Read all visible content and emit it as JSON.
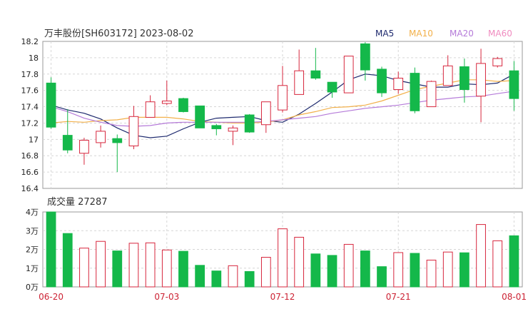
{
  "chart_data": {
    "type": "candlestick",
    "title": "万丰股份[SH603172] 2023-08-02",
    "legend": [
      {
        "label": "MA5",
        "color": "#1e2a6e"
      },
      {
        "label": "MA10",
        "color": "#f2b04a"
      },
      {
        "label": "MA20",
        "color": "#b57bd9"
      },
      {
        "label": "MA60",
        "color": "#f08cc0"
      }
    ],
    "colors": {
      "up": "#d7263d",
      "down": "#14b84a"
    },
    "price_axis": {
      "ylim": [
        16.4,
        18.2
      ],
      "ticks": [
        "18.2",
        "18",
        "17.8",
        "17.6",
        "17.4",
        "17.2",
        "17",
        "16.8",
        "16.6",
        "16.4"
      ],
      "tick_values": [
        18.2,
        18.0,
        17.8,
        17.6,
        17.4,
        17.2,
        17.0,
        16.8,
        16.6,
        16.4
      ]
    },
    "volume_title": "成交量 27287",
    "volume_axis": {
      "ylim": [
        0,
        40000
      ],
      "ticks": [
        "4万",
        "3万",
        "2万",
        "1万",
        "0万"
      ],
      "tick_values": [
        40000,
        30000,
        20000,
        10000,
        0
      ]
    },
    "x_ticks": [
      {
        "index": 0,
        "label": "06-20"
      },
      {
        "index": 7,
        "label": "07-03"
      },
      {
        "index": 14,
        "label": "07-12"
      },
      {
        "index": 21,
        "label": "07-21"
      },
      {
        "index": 28,
        "label": "08-01"
      }
    ],
    "candles": [
      {
        "o": 17.69,
        "h": 17.76,
        "l": 17.13,
        "c": 17.15,
        "v": 40000
      },
      {
        "o": 17.05,
        "h": 17.37,
        "l": 16.83,
        "c": 16.87,
        "v": 28500
      },
      {
        "o": 16.83,
        "h": 17.02,
        "l": 16.69,
        "c": 16.99,
        "v": 20700
      },
      {
        "o": 16.96,
        "h": 17.17,
        "l": 16.9,
        "c": 17.1,
        "v": 24300
      },
      {
        "o": 17.01,
        "h": 17.06,
        "l": 16.6,
        "c": 16.96,
        "v": 19200
      },
      {
        "o": 16.92,
        "h": 17.41,
        "l": 16.88,
        "c": 17.28,
        "v": 23300
      },
      {
        "o": 17.27,
        "h": 17.54,
        "l": 17.27,
        "c": 17.46,
        "v": 23500
      },
      {
        "o": 17.44,
        "h": 17.72,
        "l": 17.42,
        "c": 17.47,
        "v": 19700
      },
      {
        "o": 17.5,
        "h": 17.51,
        "l": 17.33,
        "c": 17.34,
        "v": 19000
      },
      {
        "o": 17.41,
        "h": 17.41,
        "l": 17.14,
        "c": 17.14,
        "v": 11500
      },
      {
        "o": 17.17,
        "h": 17.19,
        "l": 17.05,
        "c": 17.13,
        "v": 8500
      },
      {
        "o": 17.1,
        "h": 17.17,
        "l": 16.93,
        "c": 17.14,
        "v": 11300
      },
      {
        "o": 17.3,
        "h": 17.31,
        "l": 17.08,
        "c": 17.09,
        "v": 8200
      },
      {
        "o": 17.18,
        "h": 17.46,
        "l": 17.08,
        "c": 17.46,
        "v": 15800
      },
      {
        "o": 17.36,
        "h": 17.9,
        "l": 17.33,
        "c": 17.66,
        "v": 31000
      },
      {
        "o": 17.55,
        "h": 18.1,
        "l": 17.55,
        "c": 17.84,
        "v": 26500
      },
      {
        "o": 17.84,
        "h": 18.12,
        "l": 17.73,
        "c": 17.75,
        "v": 17600
      },
      {
        "o": 17.7,
        "h": 17.7,
        "l": 17.51,
        "c": 17.58,
        "v": 16800
      },
      {
        "o": 17.57,
        "h": 18.01,
        "l": 17.57,
        "c": 18.02,
        "v": 22700
      },
      {
        "o": 18.17,
        "h": 18.19,
        "l": 17.72,
        "c": 17.85,
        "v": 19200
      },
      {
        "o": 17.86,
        "h": 17.89,
        "l": 17.52,
        "c": 17.57,
        "v": 10800
      },
      {
        "o": 17.61,
        "h": 17.83,
        "l": 17.56,
        "c": 17.75,
        "v": 18300
      },
      {
        "o": 17.81,
        "h": 17.88,
        "l": 17.32,
        "c": 17.35,
        "v": 17900
      },
      {
        "o": 17.4,
        "h": 17.72,
        "l": 17.4,
        "c": 17.71,
        "v": 14300
      },
      {
        "o": 17.66,
        "h": 18.03,
        "l": 17.66,
        "c": 17.9,
        "v": 18600
      },
      {
        "o": 17.89,
        "h": 17.99,
        "l": 17.45,
        "c": 17.61,
        "v": 18200
      },
      {
        "o": 17.53,
        "h": 18.11,
        "l": 17.21,
        "c": 17.93,
        "v": 33300
      },
      {
        "o": 17.9,
        "h": 18.01,
        "l": 17.88,
        "c": 17.99,
        "v": 24600
      },
      {
        "o": 17.84,
        "h": 17.96,
        "l": 17.35,
        "c": 17.5,
        "v": 27287
      }
    ],
    "ma": [
      {
        "name": "MA5",
        "color": "#1e2a6e",
        "values": [
          17.42,
          17.36,
          17.32,
          17.25,
          17.14,
          17.05,
          17.02,
          17.04,
          17.13,
          17.21,
          17.26,
          17.27,
          17.28,
          17.23,
          17.21,
          17.31,
          17.44,
          17.58,
          17.73,
          17.8,
          17.78,
          17.72,
          17.68,
          17.64,
          17.64,
          17.68,
          17.67,
          17.69,
          17.8
        ]
      },
      {
        "name": "MA10",
        "color": "#f2b04a",
        "values": [
          17.2,
          17.22,
          17.21,
          17.23,
          17.24,
          17.27,
          17.27,
          17.27,
          17.25,
          17.22,
          17.21,
          17.2,
          17.2,
          17.21,
          17.24,
          17.3,
          17.34,
          17.39,
          17.4,
          17.42,
          17.47,
          17.54,
          17.61,
          17.65,
          17.69,
          17.73,
          17.73,
          17.71,
          17.72
        ]
      },
      {
        "name": "MA20",
        "color": "#b57bd9",
        "values": [
          17.4,
          17.34,
          17.26,
          17.21,
          17.17,
          17.16,
          17.17,
          17.2,
          17.21,
          17.21,
          17.21,
          17.21,
          17.21,
          17.22,
          17.24,
          17.26,
          17.28,
          17.32,
          17.35,
          17.38,
          17.4,
          17.42,
          17.45,
          17.48,
          17.5,
          17.52,
          17.53,
          17.56,
          17.59
        ]
      },
      {
        "name": "MA60",
        "color": "#f08cc0",
        "values": [
          null,
          null,
          null,
          null,
          null,
          null,
          null,
          null,
          null,
          null,
          null,
          null,
          null,
          null,
          null,
          null,
          null,
          null,
          null,
          null,
          null,
          null,
          null,
          null,
          null,
          null,
          null,
          null,
          null
        ]
      }
    ]
  }
}
